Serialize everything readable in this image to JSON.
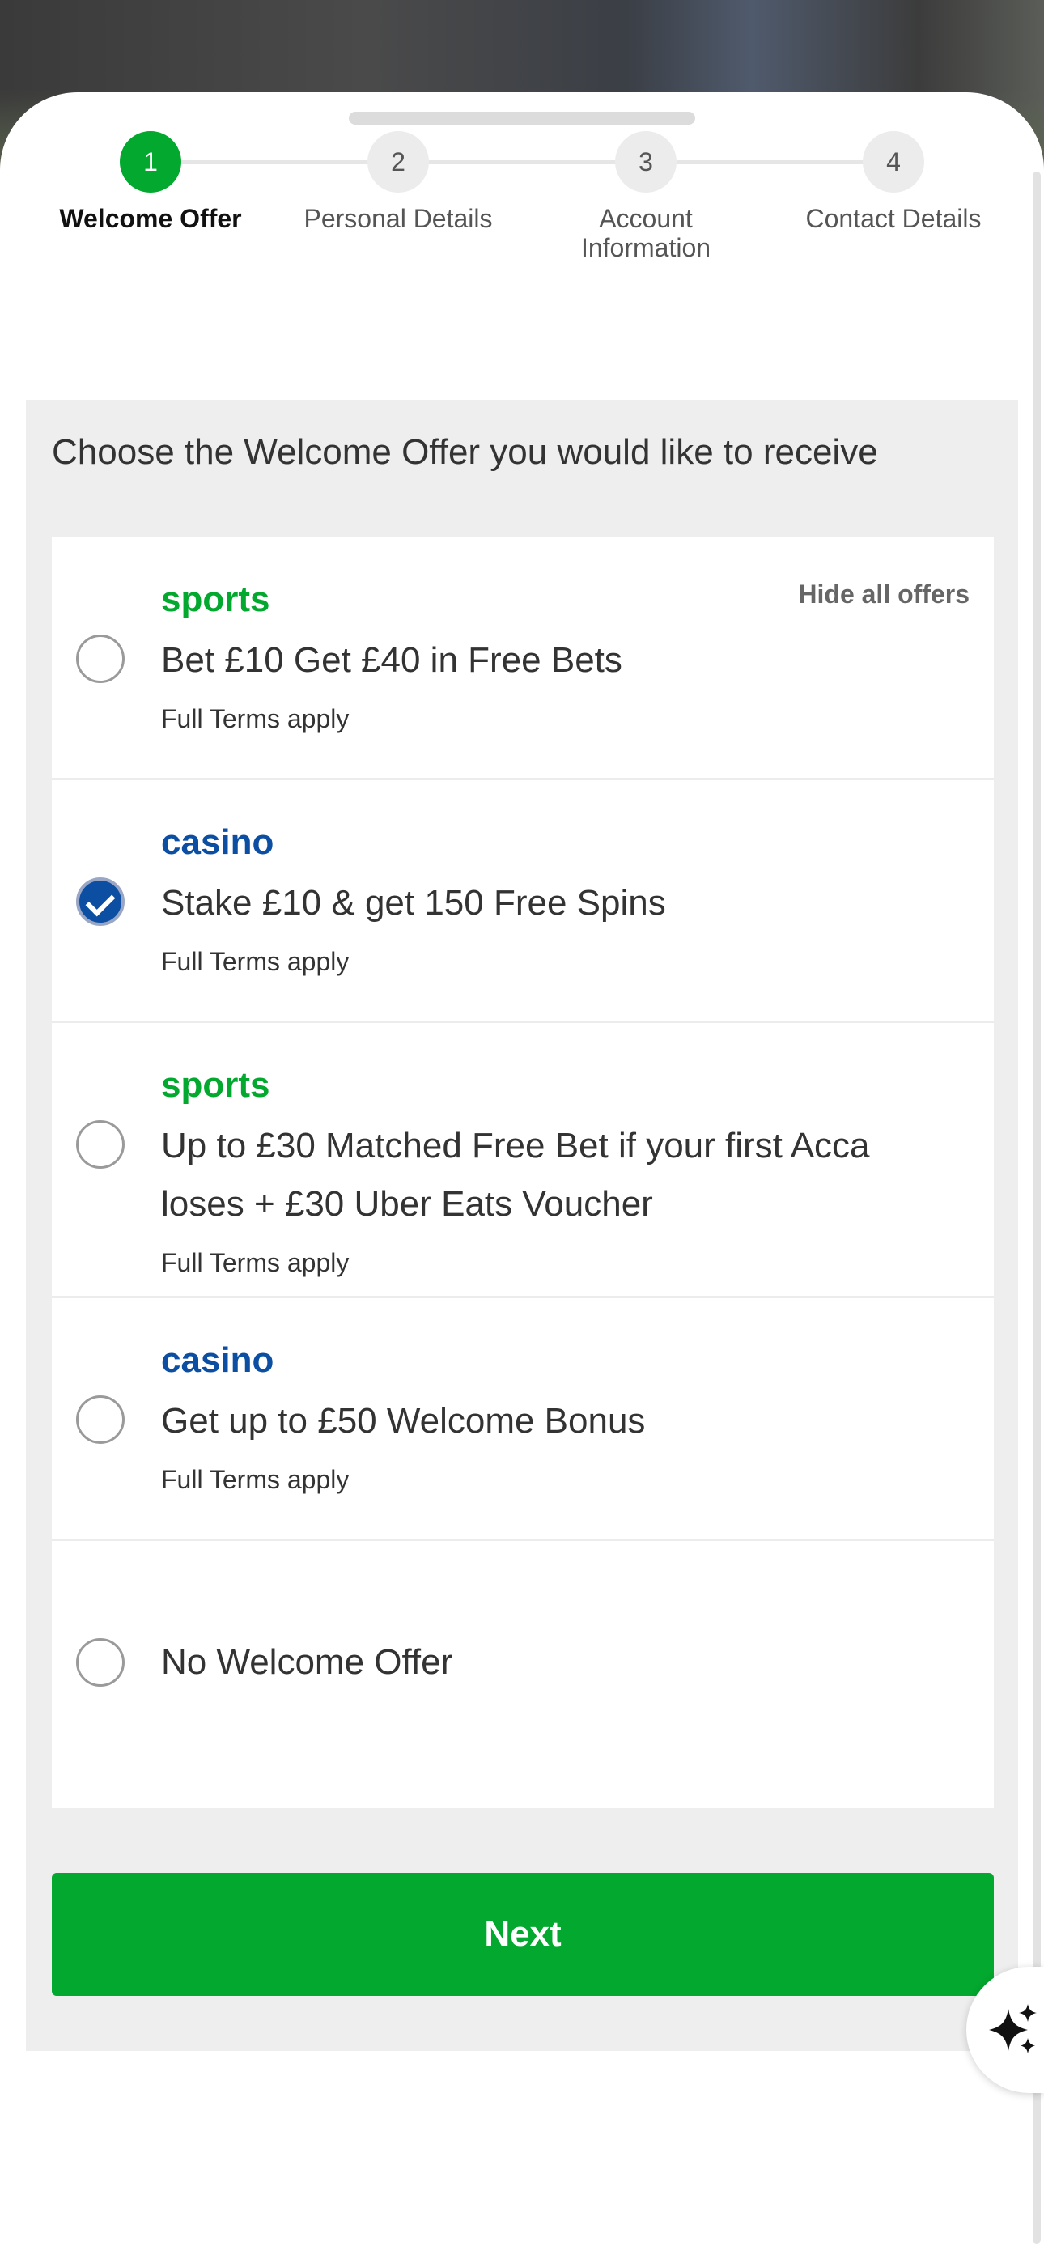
{
  "stepper": {
    "steps": [
      {
        "number": "1",
        "label": "Welcome Offer",
        "active": true
      },
      {
        "number": "2",
        "label": "Personal Details",
        "active": false
      },
      {
        "number": "3",
        "label": "Account Information",
        "active": false
      },
      {
        "number": "4",
        "label": "Contact Details",
        "active": false
      }
    ]
  },
  "panel": {
    "heading": "Choose the Welcome Offer you would like to receive",
    "hide_offers_label": "Hide all offers"
  },
  "offers": [
    {
      "category": "sports",
      "category_color": "#03a82e",
      "title": "Bet £10 Get £40 in Free Bets",
      "terms": "Full Terms apply",
      "selected": false
    },
    {
      "category": "casino",
      "category_color": "#0b4ea2",
      "title": "Stake £10 & get 150 Free Spins",
      "terms": "Full Terms apply",
      "selected": true
    },
    {
      "category": "sports",
      "category_color": "#03a82e",
      "title": "Up to £30 Matched Free Bet if your first Acca loses + £30 Uber Eats Voucher",
      "terms": "Full Terms apply",
      "selected": false
    },
    {
      "category": "casino",
      "category_color": "#0b4ea2",
      "title": "Get up to £50 Welcome Bonus",
      "terms": "Full Terms apply",
      "selected": false
    },
    {
      "category": "",
      "title": "No Welcome Offer",
      "terms": "",
      "selected": false
    }
  ],
  "next_button": {
    "label": "Next"
  },
  "colors": {
    "brand_green": "#03a82e",
    "casino_blue": "#0b4ea2"
  },
  "icons": {
    "assist": "sparkle-icon",
    "selected_radio": "check-icon"
  }
}
